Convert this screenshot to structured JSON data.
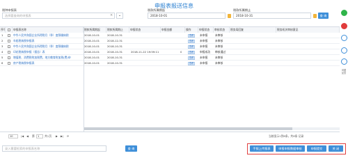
{
  "title": "申报表报送信息",
  "filters": {
    "tax_type_label": "税种申报表",
    "tax_type_placeholder": "选择要查询的申报表",
    "period_start_label": "税款所属期起",
    "period_start_value": "2018-10-01",
    "period_end_label": "税款所属期止",
    "period_end_value": "2018-10-31",
    "query_label": "查 询"
  },
  "columns": [
    "序号",
    "",
    "申报表名称",
    "税款所属期起",
    "税款所属期止",
    "申报状态",
    "申报金额",
    "操作",
    "申报状态",
    "审核状态",
    "税务局回复",
    "税务机关审核意见"
  ],
  "rows": [
    {
      "no": "1",
      "name": "中华人民共和国企业所得税月（季）度预缴纳税",
      "start": "2018-10-01",
      "end": "2018-10-31",
      "action": "查看",
      "s1": "未申报",
      "s2": "未审核"
    },
    {
      "no": "2",
      "name": "车船税纳税申报表",
      "start": "2018-10-01",
      "end": "2018-12-31",
      "action": "查看",
      "s1": "未申报",
      "s2": "未审核"
    },
    {
      "no": "3",
      "name": "中华人民共和国企业所得税月（季）度预缴纳税",
      "start": "2018-10-01",
      "end": "2018-10-31",
      "action": "查看",
      "s1": "未申报",
      "s2": "未审核"
    },
    {
      "no": "4",
      "name": "印花税纳税申报（报告）表",
      "start": "2018-10-01",
      "end": "2018-10-31",
      "date": "2018-11-22 19:59:11",
      "amount": "0",
      "action": "查看",
      "s1": "申报成功",
      "s2": "审核通过"
    },
    {
      "no": "5",
      "name": "增值税、消费税附加税费，地方教育附加税(费)申",
      "start": "2018-10-01",
      "end": "2018-10-31",
      "action": "查看",
      "s1": "未申报",
      "s2": "未审核"
    },
    {
      "no": "6",
      "name": "房产税纳税申报表",
      "start": "2018-10-01",
      "end": "2018-10-31",
      "action": "查看",
      "s1": "未申报",
      "s2": "未审核"
    }
  ],
  "pager": {
    "page_size": "10",
    "page_label": "第",
    "page_value": "1",
    "total_pages": "共1页",
    "summary": "当前显示1到6条，共6条 记录"
  },
  "bottom": {
    "search_placeholder": "录入需要检索的申报表名称",
    "search_btn": "查 询",
    "btn_hand_report": "手报上传报表",
    "btn_report_check": "申报申报数据审核",
    "btn_report_submit": "申报提交",
    "btn_close": "关 闭"
  },
  "side": {
    "label1": "问题",
    "label2": "反馈"
  }
}
